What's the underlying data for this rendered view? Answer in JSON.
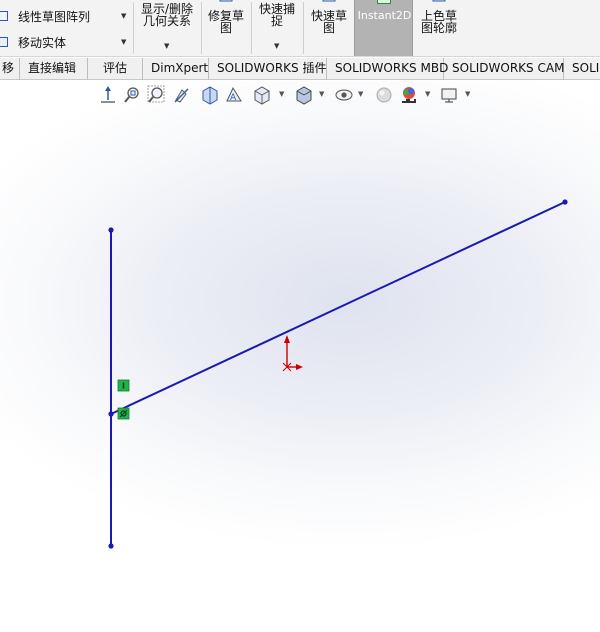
{
  "ribbon": {
    "linear_pattern_label": "线性草图阵列",
    "move_entities_label": "移动实体",
    "display_delete_relations": [
      "显示/删除",
      "几何关系"
    ],
    "repair_sketch": [
      "修复草",
      "图"
    ],
    "quick_snaps": [
      "快速捕",
      "捉"
    ],
    "rapid_sketch": [
      "快速草",
      "图"
    ],
    "instant2d_label": "Instant2D",
    "shaded_sketch_contours": [
      "上色草",
      "图轮廓"
    ]
  },
  "tabs": [
    {
      "label": "移"
    },
    {
      "label": "直接编辑"
    },
    {
      "label": "评估"
    },
    {
      "label": "DimXpert"
    },
    {
      "label": "SOLIDWORKS 插件"
    },
    {
      "label": "SOLIDWORKS MBD"
    },
    {
      "label": "SOLIDWORKS CAM"
    },
    {
      "label": "SOLI"
    }
  ],
  "heads_up_toolbar": [
    "view-orientation-icon",
    "zoom-to-fit-icon",
    "zoom-to-area-icon",
    "previous-view-icon",
    "section-view-icon",
    "view-selector-icon",
    "view-orientation-dropdown-icon",
    "display-style-icon",
    "hide-show-items-icon",
    "edit-appearance-icon",
    "apply-scene-icon",
    "view-settings-icon"
  ],
  "colors": {
    "sketch_line": "#1a1ab0",
    "relation_badge": "#22b14c",
    "origin_marker": "#cc0000",
    "instant2d_bg": "#b3b3b3"
  }
}
